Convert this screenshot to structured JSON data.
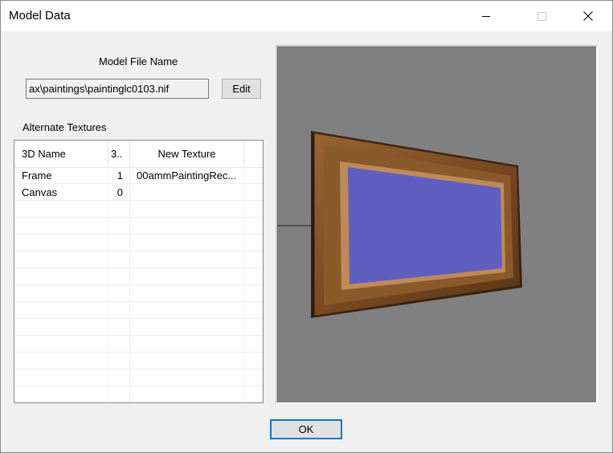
{
  "window": {
    "title": "Model Data",
    "controls": {
      "minimize": "minimize-icon",
      "maximize": "maximize-icon",
      "close": "close-icon"
    }
  },
  "model": {
    "file_label": "Model File Name",
    "file_value": "ax\\paintings\\paintinglc0103.nif",
    "edit_label": "Edit"
  },
  "textures": {
    "label": "Alternate Textures",
    "columns": [
      "3D Name",
      "3..",
      "New Texture",
      ""
    ],
    "rows": [
      {
        "name": "Frame",
        "index": "1",
        "texture": "00ammPaintingRec..."
      },
      {
        "name": "Canvas",
        "index": "0",
        "texture": ""
      }
    ]
  },
  "preview": {
    "background": "#808080",
    "canvas_color": "#5e5fbf",
    "frame_color": "#7a4a22"
  },
  "footer": {
    "ok_label": "OK"
  }
}
